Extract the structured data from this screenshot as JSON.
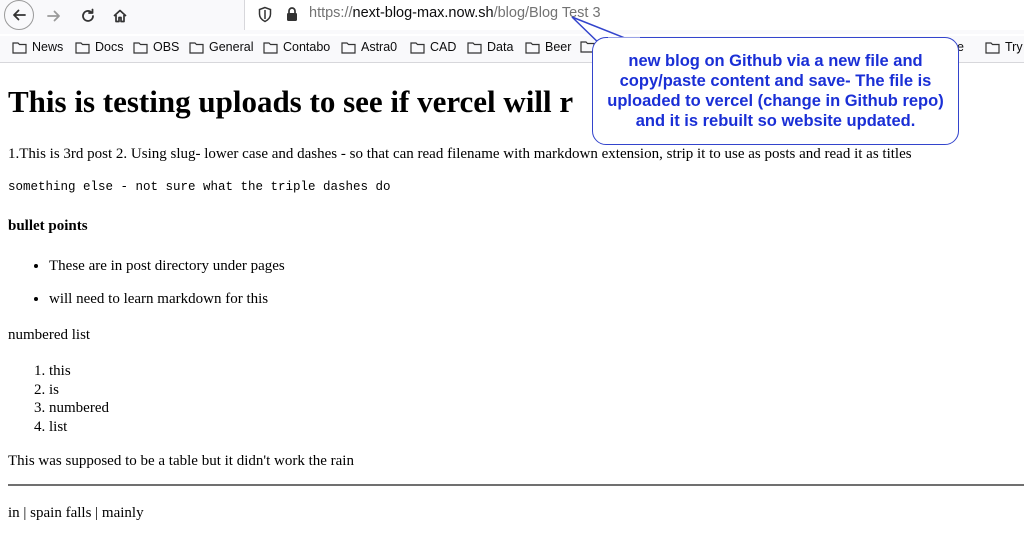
{
  "browser": {
    "url_scheme": "https://",
    "url_host": "next-blog-max.now.sh",
    "url_path": "/blog/Blog Test 3"
  },
  "bookmarks": [
    "News",
    "Docs",
    "OBS",
    "General",
    "Contabo",
    "Astra0",
    "CAD",
    "Data",
    "Beer",
    "e",
    "Try F"
  ],
  "page": {
    "heading": "This is testing uploads to see if vercel will r",
    "intro": "1.This is 3rd post 2. Using slug- lower case and dashes - so that can read filename with markdown extension, strip it to use as posts and read it as titles",
    "code_line": "something else - not sure what the triple dashes do",
    "bullet_heading": "bullet points",
    "bullets": [
      "These are in post directory under pages",
      "will need to learn markdown for this"
    ],
    "numbered_heading": "numbered list",
    "numbered": [
      "this",
      "is",
      "numbered",
      "list"
    ],
    "table_note": "This was supposed to be a table but it didn't work the rain",
    "footer_line": "in | spain falls | mainly"
  },
  "annotation": {
    "text": "new blog on Github via a new file and copy/paste content and save- The file is uploaded to vercel (change in Github repo) and it is rebuilt so website updated.",
    "color": "#1a2fd6"
  }
}
